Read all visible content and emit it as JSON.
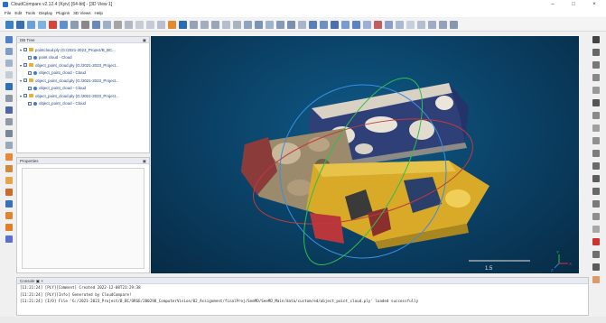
{
  "window": {
    "title": "CloudCompare v2.12.4 (Kyiv) [64-bit] - [3D View 1]",
    "minimize": "–",
    "maximize": "□",
    "close": "×"
  },
  "menu": [
    "File",
    "Edit",
    "Tools",
    "Display",
    "Plugins",
    "3D Views",
    "Help"
  ],
  "db_tree": {
    "title": "DB Tree",
    "items": [
      {
        "label": "pointcloud.ply (G:/2021-2023_Project/B_BC...",
        "level": 0
      },
      {
        "label": "point cloud - Cloud",
        "level": 1
      },
      {
        "label": "object_point_cloud.ply (G:/2021-2023_Project...",
        "level": 0
      },
      {
        "label": "object_point_cloud - Cloud",
        "level": 1
      },
      {
        "label": "object_point_cloud.ply (G:/2021-2023_Project...",
        "level": 0
      },
      {
        "label": "object_point_cloud - Cloud",
        "level": 1
      },
      {
        "label": "object_point_cloud.ply (G:/2021-2023_Project...",
        "level": 0
      },
      {
        "label": "object_point_cloud - Cloud",
        "level": 1
      }
    ]
  },
  "properties": {
    "title": "Properties"
  },
  "viewport": {
    "scale_label": "1.5",
    "axis_labels": [
      "Y",
      "X",
      "Z"
    ]
  },
  "console": {
    "title": "Console",
    "lines": [
      "[11:21:24] [PLY][Comment] Created 2022-12-08T21:29:38",
      "[11:21:24] [PLY][Info] Generated by CloudCompare!",
      "[11:21:24] [I/O] File 'G:/2021-2023_Project/B_BC/ORSE/200298_ComputerVision/02_Assignment/finalProj/SeeMD/SeeMD_Main/data/custom/ed/object_point_cloud.ply' loaded successfully"
    ]
  },
  "colors": {
    "accent": "#2a6fd6",
    "viewport_bg": "#0a3f63",
    "folder": "#e8b23a"
  }
}
